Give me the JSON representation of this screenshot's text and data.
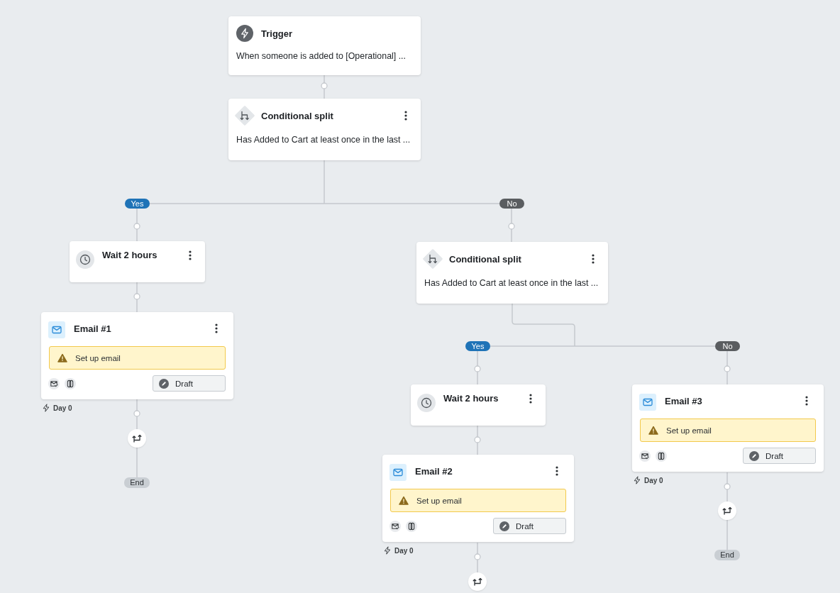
{
  "steps": [
    {
      "kind": "trigger",
      "title": "Trigger",
      "description": "When someone is added to [Operational] ..."
    },
    {
      "kind": "split",
      "title": "Conditional split",
      "description": "Has Added to Cart at least once in the last ..."
    },
    {
      "kind": "wait",
      "title": "Wait 2 hours"
    },
    {
      "kind": "split",
      "title": "Conditional split",
      "description": "Has Added to Cart at least once in the last ..."
    },
    {
      "kind": "email",
      "title": "Email #1",
      "warning": "Set up email",
      "status": "Draft",
      "day": "Day 0"
    },
    {
      "kind": "wait",
      "title": "Wait 2 hours"
    },
    {
      "kind": "email",
      "title": "Email #3",
      "warning": "Set up email",
      "status": "Draft",
      "day": "Day 0"
    },
    {
      "kind": "email",
      "title": "Email #2",
      "warning": "Set up email",
      "status": "Draft",
      "day": "Day 0"
    }
  ],
  "branch_labels": [
    {
      "kind": "yes",
      "label": "Yes"
    },
    {
      "kind": "no",
      "label": "No"
    },
    {
      "kind": "yes",
      "label": "Yes"
    },
    {
      "kind": "no",
      "label": "No"
    }
  ],
  "end_labels": [
    "End",
    "End"
  ]
}
